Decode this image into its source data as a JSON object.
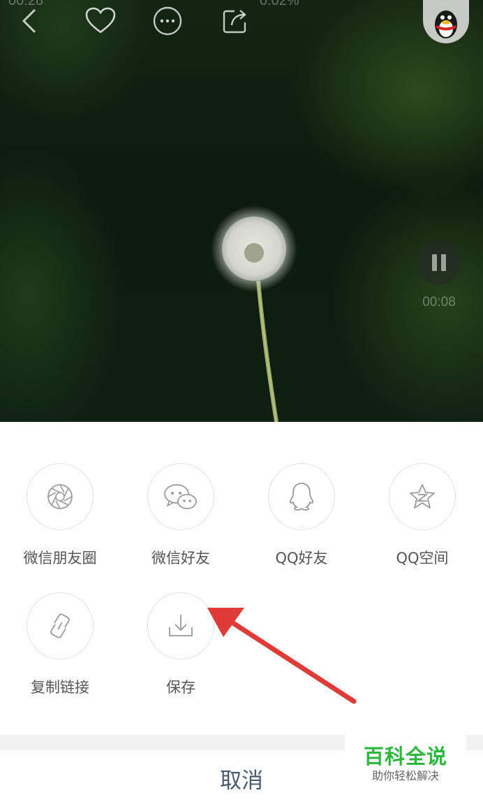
{
  "status_bar": {
    "time": "00:28",
    "network_text": "0.02%"
  },
  "toolbar": {
    "icons": [
      "back-icon",
      "heart-icon",
      "more-icon",
      "share-icon",
      "qq-avatar-icon"
    ]
  },
  "video": {
    "elapsed": "00:08",
    "state_icon": "pause-icon"
  },
  "share_sheet": {
    "items": [
      {
        "label": "微信朋友圈",
        "icon": "moments-icon"
      },
      {
        "label": "微信好友",
        "icon": "wechat-icon"
      },
      {
        "label": "QQ好友",
        "icon": "qq-icon"
      },
      {
        "label": "QQ空间",
        "icon": "qzone-icon"
      },
      {
        "label": "复制链接",
        "icon": "link-icon"
      },
      {
        "label": "保存",
        "icon": "download-icon"
      }
    ],
    "cancel_label": "取消"
  },
  "watermark": {
    "title": "百科全说",
    "subtitle": "助你轻松解决"
  },
  "colors": {
    "annotation_arrow": "#e03b36",
    "watermark_green": "#2db83d",
    "cancel_text": "#4a5a70",
    "label_text": "#555555"
  }
}
